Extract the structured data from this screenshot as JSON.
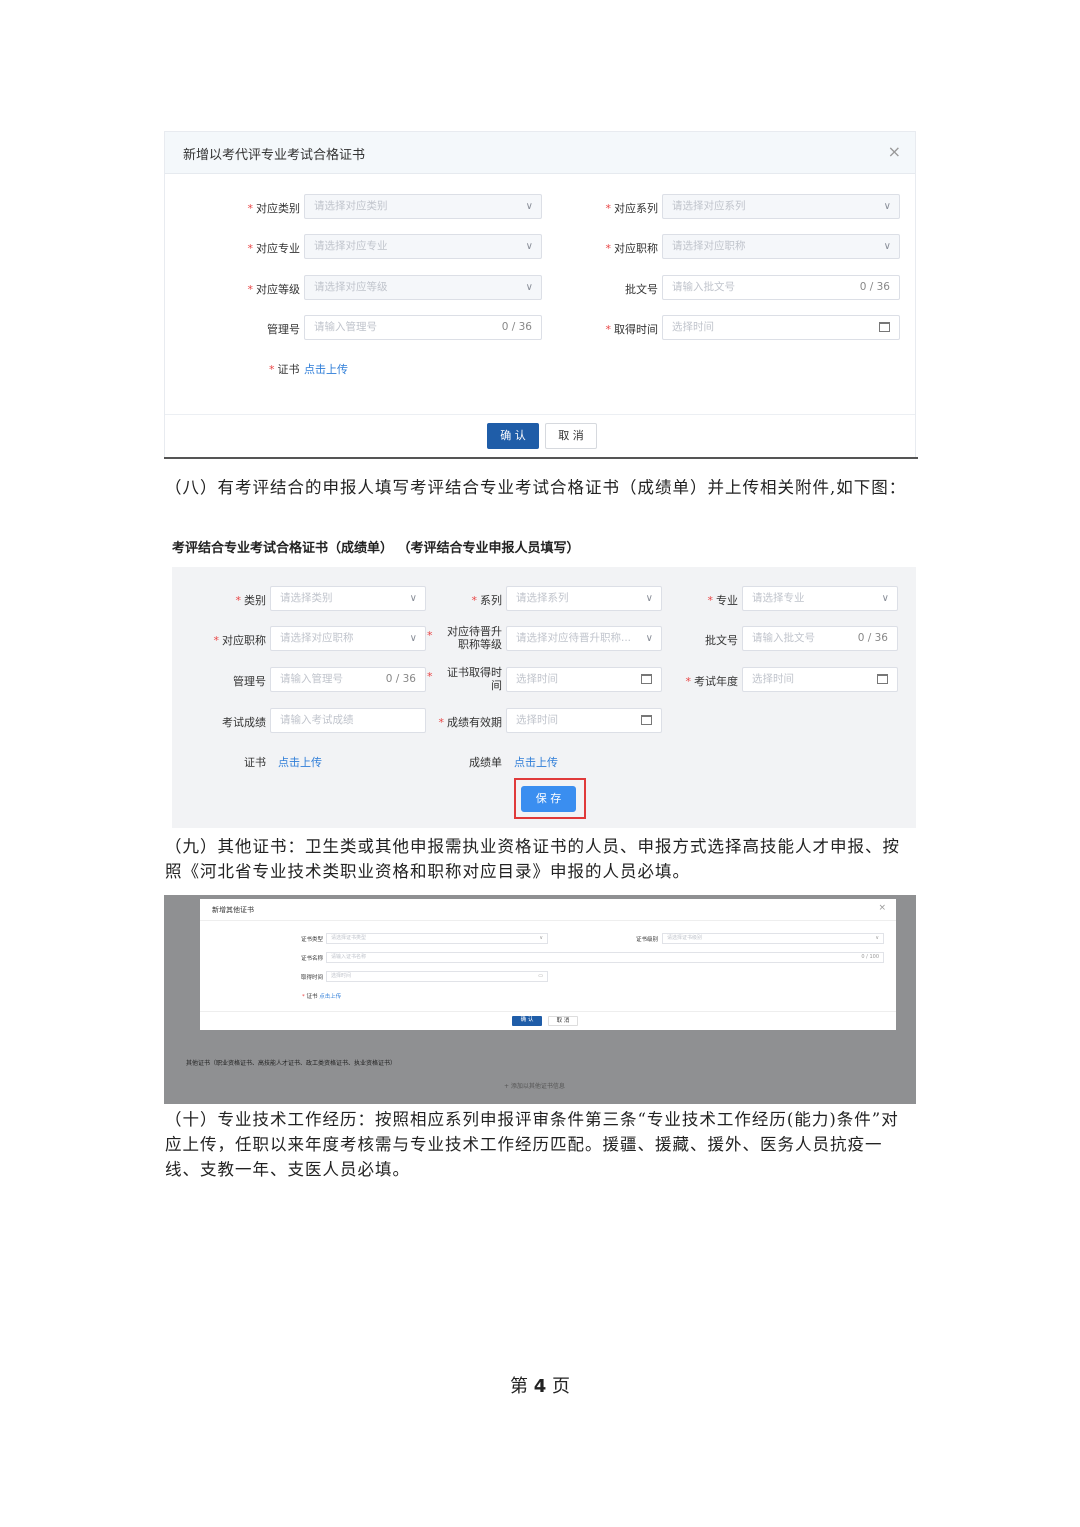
{
  "dialog1": {
    "title": "新增以考代评专业考试合格证书",
    "close": "×",
    "fields": [
      {
        "label": "对应类别",
        "placeholder": "请选择对应类别"
      },
      {
        "label": "对应系列",
        "placeholder": "请选择对应系列"
      },
      {
        "label": "对应专业",
        "placeholder": "请选择对应专业"
      },
      {
        "label": "对应职称",
        "placeholder": "请选择对应职称"
      },
      {
        "label": "对应等级",
        "placeholder": "请选择对应等级"
      },
      {
        "label": "批文号",
        "placeholder": "请输入批文号",
        "count": "0 / 36"
      },
      {
        "label": "管理号",
        "placeholder": "请输入管理号",
        "count": "0 / 36"
      },
      {
        "label": "取得时间",
        "placeholder": "选择时间"
      }
    ],
    "cert_label": "证书",
    "upload_link": "点击上传",
    "confirm": "确 认",
    "cancel": "取 消"
  },
  "para8": "（八）有考评结合的申报人填写考评结合专业考试合格证书（成绩单）并上传相关附件,如下图：",
  "section2_title": "考评结合专业考试合格证书（成绩单） （考评结合专业申报人员填写）",
  "panel2": {
    "fields": [
      {
        "label": "类别",
        "placeholder": "请选择类别"
      },
      {
        "label": "系列",
        "placeholder": "请选择系列"
      },
      {
        "label": "专业",
        "placeholder": "请选择专业"
      },
      {
        "label": "对应职称",
        "placeholder": "请选择对应职称"
      },
      {
        "label": "对应待晋升职称等级",
        "placeholder": "请选择对应待晋升职称..."
      },
      {
        "label": "批文号",
        "placeholder": "请输入批文号",
        "count": "0 / 36"
      },
      {
        "label": "管理号",
        "placeholder": "请输入管理号",
        "count": "0 / 36"
      },
      {
        "label": "证书取得时间",
        "placeholder": "选择时间"
      },
      {
        "label": "考试年度",
        "placeholder": "选择时间"
      },
      {
        "label": "考试成绩",
        "placeholder": "请输入考试成绩"
      },
      {
        "label": "成绩有效期",
        "placeholder": "选择时间"
      }
    ],
    "cert_label": "证书",
    "score_label": "成绩单",
    "upload_link": "点击上传",
    "save": "保 存"
  },
  "para9": "（九）其他证书：卫生类或其他申报需执业资格证书的人员、申报方式选择高技能人才申报、按照《河北省专业技术类职业资格和职称对应目录》申报的人员必填。",
  "shot3": {
    "title": "新增其他证书",
    "close": "×",
    "fields": [
      {
        "label": "证书类型",
        "placeholder": "请选择证书类型"
      },
      {
        "label": "证书级别",
        "placeholder": "请选择证书级别"
      },
      {
        "label": "证书名称",
        "placeholder": "请输入证书名称",
        "count": "0 / 100"
      },
      {
        "label": "取得时间",
        "placeholder": "选择时间"
      }
    ],
    "cert_label": "证书",
    "upload_link": "点击上传",
    "confirm": "确 认",
    "cancel": "取 消",
    "below_text": "其他证书（职业资格证书、高技能人才证书、政工类资格证书、执业资格证书）",
    "add_text": "+ 添加以其他证书信息"
  },
  "para10": "（十）专业技术工作经历：按照相应系列申报评审条件第三条“专业技术工作经历(能力)条件”对应上传，任职以来年度考核需与专业技术工作经历匹配。援疆、援藏、援外、医务人员抗疫一线、支教一年、支医人员必填。",
  "footer": {
    "pre": "第",
    "num": "4",
    "post": "页"
  }
}
